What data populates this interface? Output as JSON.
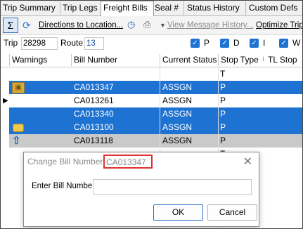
{
  "tabs": [
    "Trip Summary",
    "Trip Legs",
    "Freight Bills",
    "Seal #",
    "Status History",
    "Custom Defs"
  ],
  "toolbar": {
    "directions": "Directions to Location...",
    "view_history": "View Message History...",
    "optimize": "Optimize Trip..."
  },
  "filter": {
    "trip_label": "Trip",
    "trip_value": "28298",
    "route_label": "Route",
    "route_value": "13",
    "checks": [
      "P",
      "D",
      "I",
      "W"
    ]
  },
  "grid": {
    "headers": [
      "Warnings",
      "Bill Number",
      "Current Status",
      "Stop Type",
      "TL Stop"
    ],
    "rows": [
      {
        "bill": "",
        "status": "",
        "stop_type": "T",
        "icon": "",
        "selected": false
      },
      {
        "bill": "CA013347",
        "status": "ASSGN",
        "stop_type": "P",
        "icon": "package-icon",
        "selected": true
      },
      {
        "bill": "CA013261",
        "status": "ASSGN",
        "stop_type": "P",
        "icon": "",
        "selected": false,
        "pointer": true
      },
      {
        "bill": "CA013340",
        "status": "ASSGN",
        "stop_type": "P",
        "icon": "",
        "selected": true
      },
      {
        "bill": "CA013100",
        "status": "ASSGN",
        "stop_type": "P",
        "icon": "message-icon",
        "selected": true
      },
      {
        "bill": "CA013118",
        "status": "ASSGN",
        "stop_type": "P",
        "icon": "upload-icon",
        "selected": false,
        "gray": true
      },
      {
        "bill": "",
        "status": "",
        "stop_type": "T",
        "icon": "",
        "selected": false
      }
    ]
  },
  "dialog": {
    "title": "Change Bill Number:",
    "bill": "CA013347",
    "label": "Enter Bill Number",
    "input_value": "",
    "ok": "OK",
    "cancel": "Cancel"
  },
  "colors": {
    "selection": "#1e72d2",
    "highlight_border": "#e03030"
  }
}
